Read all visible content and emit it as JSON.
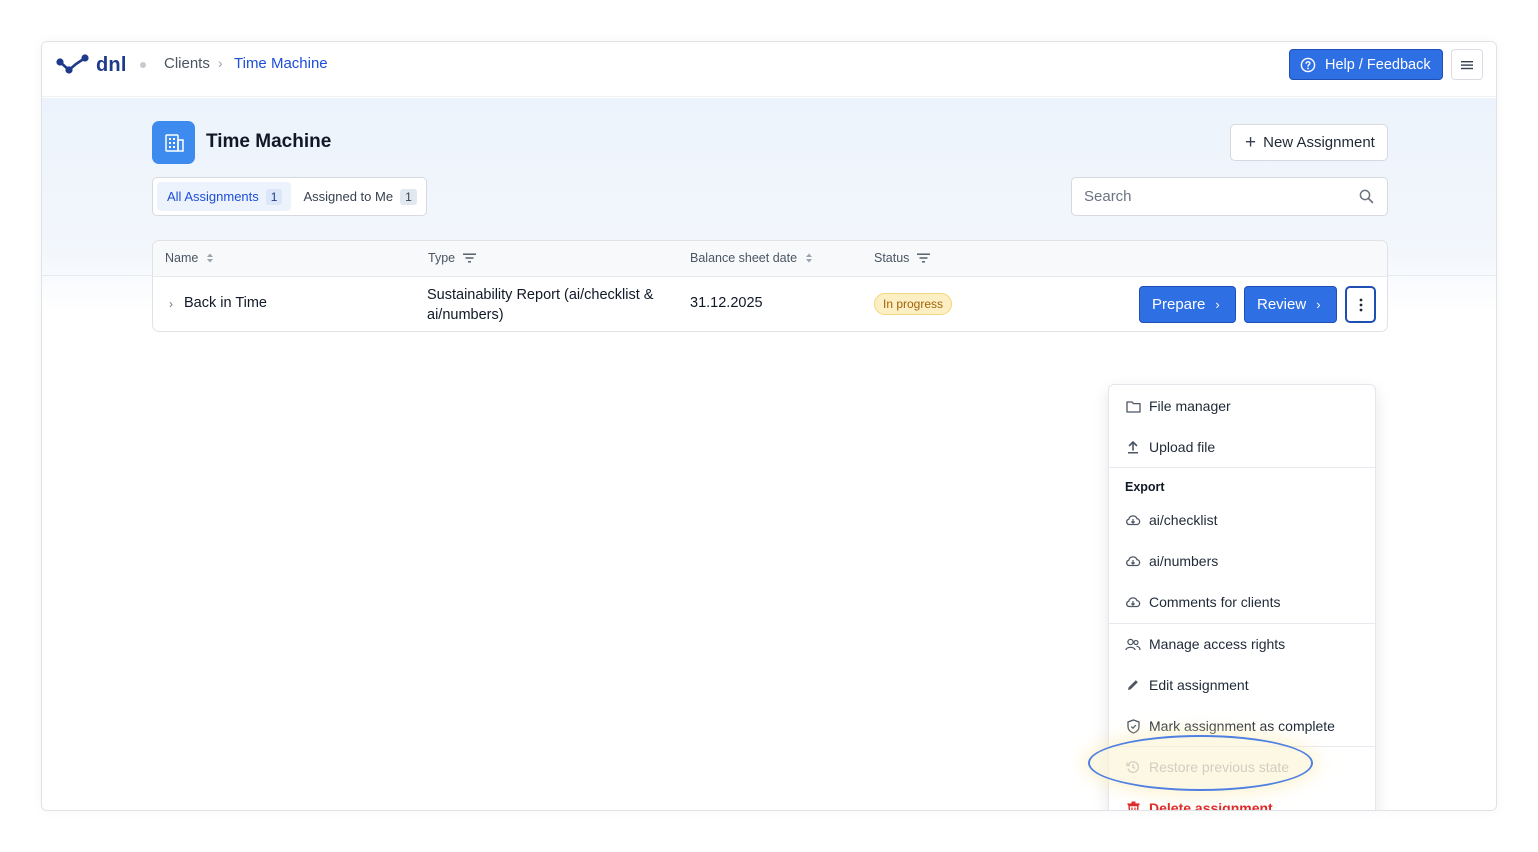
{
  "app": {
    "logo_text": "dnl"
  },
  "breadcrumb": {
    "clients": "Clients",
    "separator": "›",
    "current": "Time Machine"
  },
  "header": {
    "help_label": "Help / Feedback",
    "menu_icon": "hamburger-icon"
  },
  "page": {
    "title": "Time Machine",
    "icon": "building-icon",
    "new_assignment_label": "New Assignment"
  },
  "tabs": [
    {
      "label": "All Assignments",
      "count": "1",
      "active": true
    },
    {
      "label": "Assigned to Me",
      "count": "1",
      "active": false
    }
  ],
  "search": {
    "placeholder": "Search"
  },
  "table": {
    "columns": [
      {
        "label": "Name",
        "control": "sort"
      },
      {
        "label": "Type",
        "control": "filter"
      },
      {
        "label": "Balance sheet date",
        "control": "sort"
      },
      {
        "label": "Status",
        "control": "filter"
      }
    ],
    "rows": [
      {
        "name": "Back in Time",
        "type_line1": "Sustainability Report (ai/checklist &",
        "type_line2": "ai/numbers)",
        "date": "31.12.2025",
        "status": "In progress",
        "prepare_label": "Prepare",
        "review_label": "Review"
      }
    ]
  },
  "menu": {
    "file_manager": "File manager",
    "upload_file": "Upload file",
    "export_label": "Export",
    "export_checklist": "ai/checklist",
    "export_numbers": "ai/numbers",
    "export_comments": "Comments for clients",
    "manage_access": "Manage access rights",
    "edit_assignment": "Edit assignment",
    "mark_complete": "Mark assignment as complete",
    "restore_state": "Restore previous state",
    "delete_assignment": "Delete assignment"
  },
  "colors": {
    "primary": "#2f6fe4",
    "primary_dark": "#1f4fb5",
    "status_bg": "#fdefc4",
    "status_text": "#a16207",
    "danger": "#dc2626"
  }
}
